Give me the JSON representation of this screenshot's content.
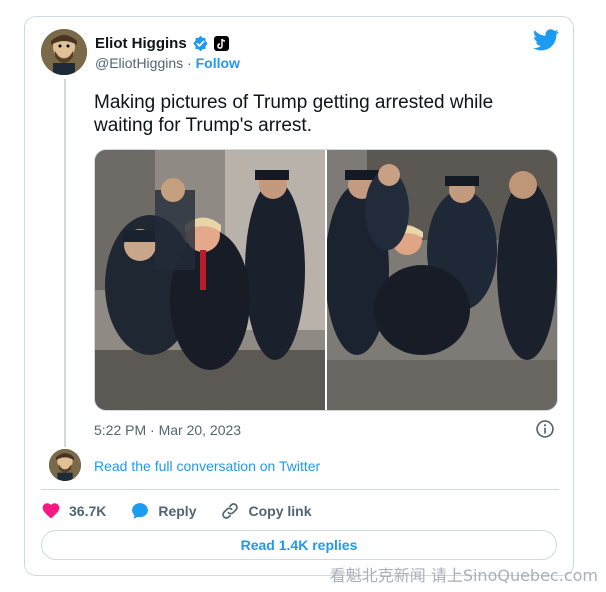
{
  "author": {
    "name": "Eliot Higgins",
    "handle": "@EliotHiggins",
    "separator": " · ",
    "follow_label": "Follow"
  },
  "tweet": {
    "text": "Making pictures of Trump getting arrested while waiting for Trump's arrest.",
    "timestamp": "5:22 PM · Mar 20, 2023"
  },
  "thread": {
    "read_conversation": "Read the full conversation on Twitter"
  },
  "actions": {
    "like_count": "36.7K",
    "reply_label": "Reply",
    "copy_link_label": "Copy link",
    "read_replies_label": "Read 1.4K replies"
  },
  "watermark": "看魁北克新闻 请上SinoQuebec.com",
  "colors": {
    "accent": "#1d9bf0",
    "like": "#f91880",
    "border": "#cfd9de",
    "muted_text": "#536471"
  },
  "icons": [
    "verified-badge-icon",
    "tiktok-badge-icon",
    "twitter-logo-icon",
    "info-icon",
    "heart-icon",
    "reply-bubble-icon",
    "link-icon"
  ]
}
